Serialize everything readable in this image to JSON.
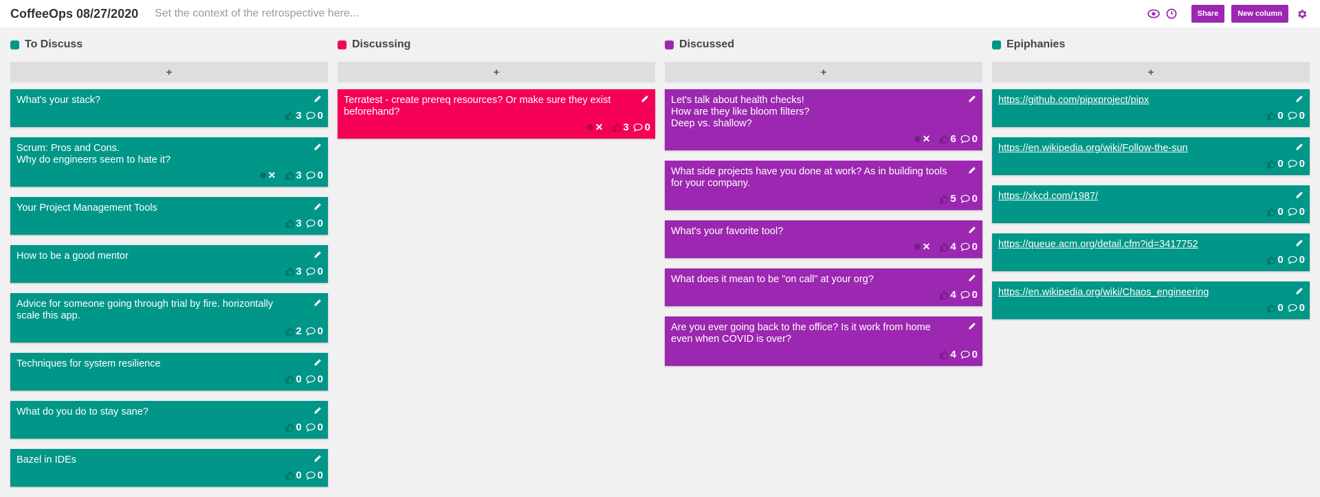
{
  "board": {
    "title": "CoffeeOps 08/27/2020",
    "context_placeholder": "Set the context of the retrospective here...",
    "share_label": "Share",
    "new_column_label": "New column",
    "add_label": "+"
  },
  "colors": {
    "teal": "#009688",
    "pink": "#f50057",
    "purple": "#9c27b0"
  },
  "columns": [
    {
      "title": "To Discuss",
      "color": "#009688",
      "cards": [
        {
          "text": "What's your stack?",
          "votes": "3",
          "comments": "0"
        },
        {
          "text": "Scrum: Pros and Cons.\nWhy do engineers seem to hate it?",
          "votes": "3",
          "comments": "0",
          "voted": true
        },
        {
          "text": "Your Project Management Tools",
          "votes": "3",
          "comments": "0"
        },
        {
          "text": "How to be a good mentor",
          "votes": "3",
          "comments": "0"
        },
        {
          "text": "Advice for someone going through trial by fire. horizontally scale this app.",
          "votes": "2",
          "comments": "0"
        },
        {
          "text": "Techniques for system resilience",
          "votes": "0",
          "comments": "0"
        },
        {
          "text": "What do you do to stay sane?",
          "votes": "0",
          "comments": "0"
        },
        {
          "text": "Bazel in IDEs",
          "votes": "0",
          "comments": "0"
        }
      ]
    },
    {
      "title": "Discussing",
      "color": "#f50057",
      "cards": [
        {
          "text": "Terratest - create prereq resources? Or make sure they exist beforehand?",
          "votes": "3",
          "comments": "0",
          "voted": true
        }
      ]
    },
    {
      "title": "Discussed",
      "color": "#9c27b0",
      "cards": [
        {
          "text": "Let's talk about health checks!\nHow are they like bloom filters?\nDeep vs. shallow?",
          "votes": "6",
          "comments": "0",
          "voted": true
        },
        {
          "text": "What side projects have you done at work? As in building tools for your company.",
          "votes": "5",
          "comments": "0"
        },
        {
          "text": "What's your favorite tool?",
          "votes": "4",
          "comments": "0",
          "voted": true
        },
        {
          "text": "What does it mean to be \"on call\" at your org?",
          "votes": "4",
          "comments": "0"
        },
        {
          "text": "Are you ever going back to the office? Is it work from home even when COVID is over?",
          "votes": "4",
          "comments": "0"
        }
      ]
    },
    {
      "title": "Epiphanies",
      "color": "#009688",
      "cards": [
        {
          "text": "https://github.com/pipxproject/pipx",
          "link": true,
          "votes": "0",
          "comments": "0"
        },
        {
          "text": "https://en.wikipedia.org/wiki/Follow-the-sun",
          "link": true,
          "votes": "0",
          "comments": "0"
        },
        {
          "text": "https://xkcd.com/1987/",
          "link": true,
          "votes": "0",
          "comments": "0"
        },
        {
          "text": "https://queue.acm.org/detail.cfm?id=3417752",
          "link": true,
          "votes": "0",
          "comments": "0"
        },
        {
          "text": "https://en.wikipedia.org/wiki/Chaos_engineering",
          "link": true,
          "votes": "0",
          "comments": "0"
        }
      ]
    }
  ]
}
